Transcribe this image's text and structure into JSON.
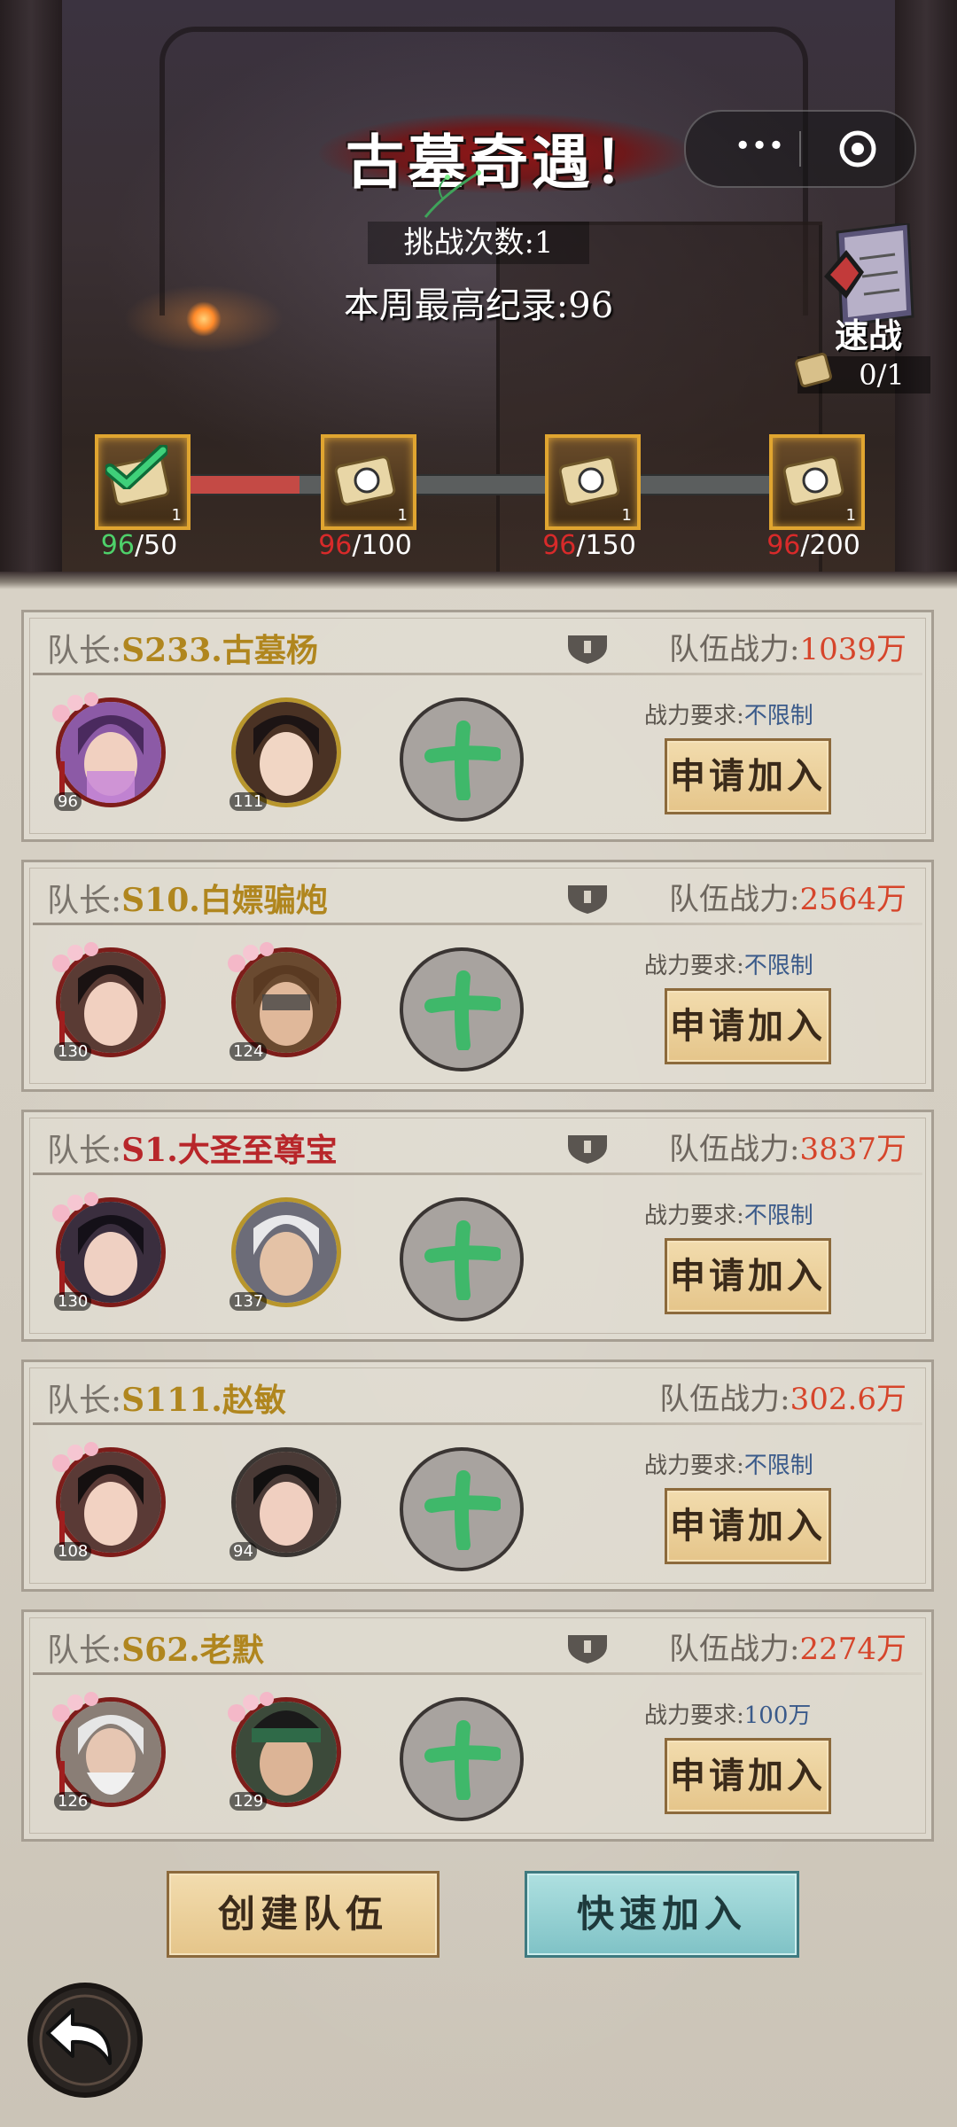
{
  "header": {
    "title": "古墓奇遇！",
    "challenge_count": "挑战次数:1",
    "weekly_record": "本周最高纪录:96",
    "quick_battle_label": "速战",
    "quick_battle_count": "0/1",
    "capsule_more": "•••"
  },
  "milestones": [
    {
      "current": "96",
      "target": "/50",
      "qty": "1",
      "claimed": true
    },
    {
      "current": "96",
      "target": "/100",
      "qty": "1",
      "claimed": false
    },
    {
      "current": "96",
      "target": "/150",
      "qty": "1",
      "claimed": false
    },
    {
      "current": "96",
      "target": "/200",
      "qty": "1",
      "claimed": false
    }
  ],
  "progress_fraction": 0.22,
  "teams": [
    {
      "leader_prefix": "队长:",
      "leader_name": "S233.古墓杨",
      "power_label": "队伍战力:",
      "power_value": "1039万",
      "req_label": "战力要求:",
      "req_value": "不限制",
      "apply_label": "申请加入",
      "members": [
        {
          "level": "96"
        },
        {
          "level": "111"
        }
      ]
    },
    {
      "leader_prefix": "队长:",
      "leader_name": "S10.白嫖骗炮",
      "power_label": "队伍战力:",
      "power_value": "2564万",
      "req_label": "战力要求:",
      "req_value": "不限制",
      "apply_label": "申请加入",
      "members": [
        {
          "level": "130"
        },
        {
          "level": "124"
        }
      ]
    },
    {
      "leader_prefix": "队长:",
      "leader_name": "S1.大圣至尊宝",
      "power_label": "队伍战力:",
      "power_value": "3837万",
      "req_label": "战力要求:",
      "req_value": "不限制",
      "apply_label": "申请加入",
      "members": [
        {
          "level": "130"
        },
        {
          "level": "137"
        }
      ]
    },
    {
      "leader_prefix": "队长:",
      "leader_name": "S111.赵敏",
      "power_label": "队伍战力:",
      "power_value": "302.6万",
      "req_label": "战力要求:",
      "req_value": "不限制",
      "apply_label": "申请加入",
      "members": [
        {
          "level": "108"
        },
        {
          "level": "94"
        }
      ]
    },
    {
      "leader_prefix": "队长:",
      "leader_name": "S62.老默",
      "power_label": "队伍战力:",
      "power_value": "2274万",
      "req_label": "战力要求:",
      "req_value": "100万",
      "apply_label": "申请加入",
      "members": [
        {
          "level": "126"
        },
        {
          "level": "129"
        }
      ]
    }
  ],
  "footer": {
    "create_team": "创建队伍",
    "quick_join": "快速加入"
  },
  "colors": {
    "leader_gold": "#b0861e",
    "leader_red": "#b8262a",
    "power_value": "#d6452b",
    "progress_fill": "#c44a45"
  }
}
